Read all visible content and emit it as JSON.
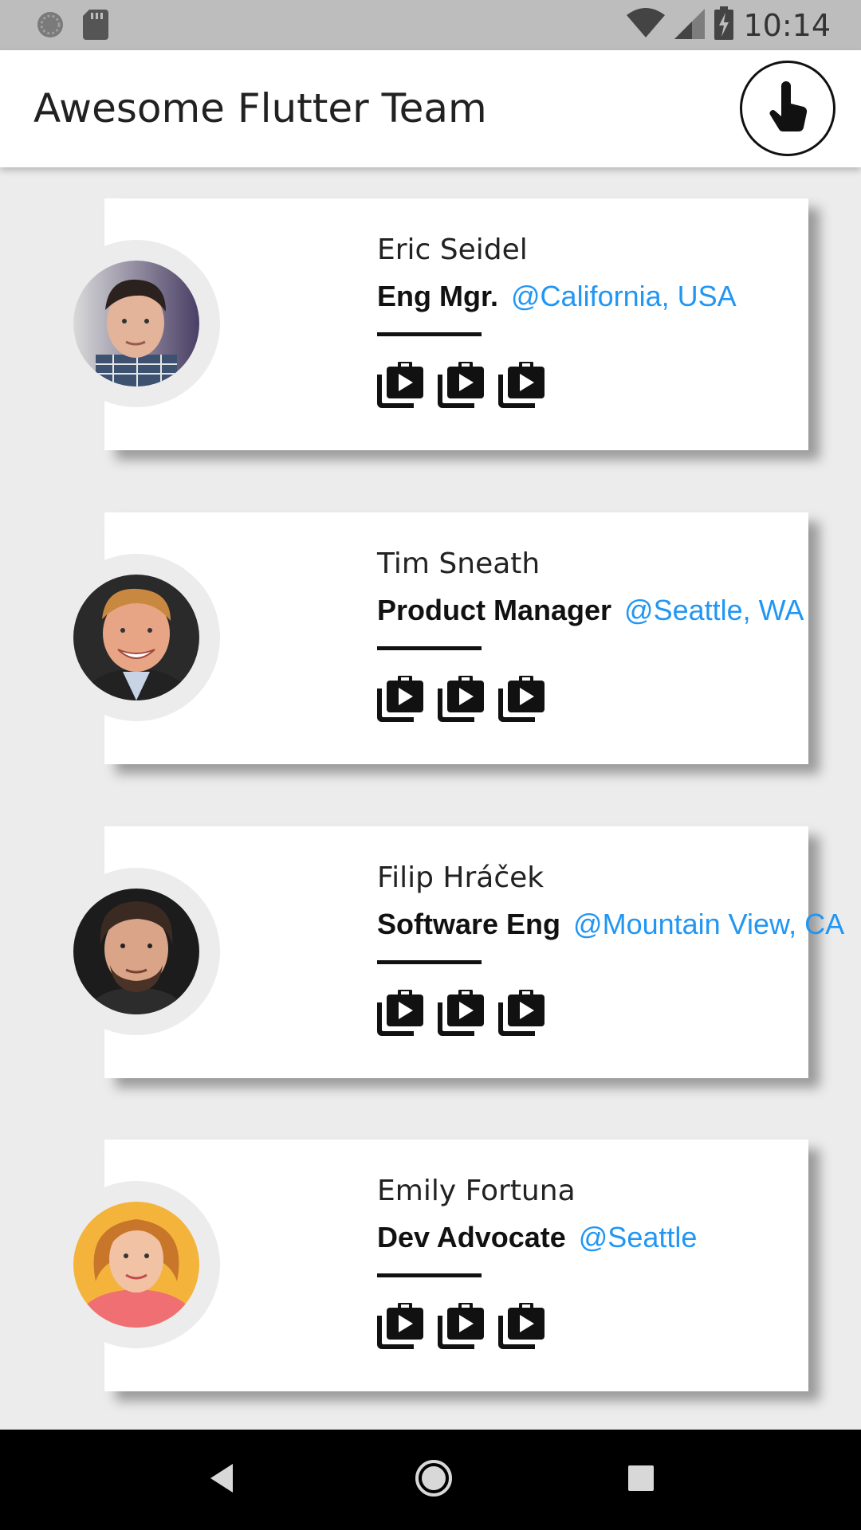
{
  "status_bar": {
    "time": "10:14",
    "icons": [
      "sync-icon",
      "sd-card-icon",
      "wifi-icon",
      "signal-icon",
      "battery-charging-icon"
    ]
  },
  "app_bar": {
    "title": "Awesome Flutter Team",
    "action_icon": "touch-icon"
  },
  "members": [
    {
      "name": "Eric Seidel",
      "role": "Eng Mgr.",
      "location": "@California, USA",
      "action_icons": [
        "video-library-icon",
        "video-library-icon",
        "video-library-icon"
      ]
    },
    {
      "name": "Tim Sneath",
      "role": "Product Manager",
      "location": "@Seattle, WA",
      "action_icons": [
        "video-library-icon",
        "video-library-icon",
        "video-library-icon"
      ]
    },
    {
      "name": "Filip Hráček",
      "role": "Software Eng",
      "location": "@Mountain View, CA",
      "action_icons": [
        "video-library-icon",
        "video-library-icon",
        "video-library-icon"
      ]
    },
    {
      "name": "Emily Fortuna",
      "role": "Dev Advocate",
      "location": "@Seattle",
      "action_icons": [
        "video-library-icon",
        "video-library-icon",
        "video-library-icon"
      ]
    }
  ],
  "colors": {
    "accent_link": "#2196f3",
    "background": "#ececec",
    "status_bar": "#bdbdbd"
  },
  "nav_bar": {
    "icons": [
      "back-icon",
      "home-icon",
      "recents-icon"
    ]
  }
}
